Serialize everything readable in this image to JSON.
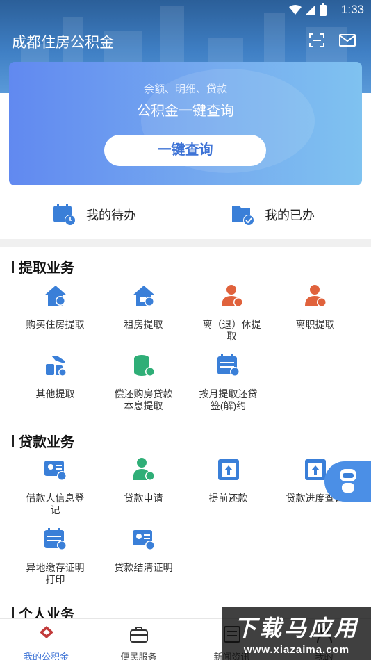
{
  "status_bar": {
    "time": "1:33"
  },
  "header": {
    "title": "成都住房公积金"
  },
  "query_card": {
    "subtitle": "余额、明细、贷款",
    "title": "公积金一键查询",
    "button_label": "一键查询"
  },
  "todo": {
    "pending_label": "我的待办",
    "done_label": "我的已办"
  },
  "sections": {
    "withdraw": {
      "title": "提取业务",
      "items": [
        {
          "label": "购买住房提取"
        },
        {
          "label": "租房提取"
        },
        {
          "label": "离（退）休提取"
        },
        {
          "label": "离职提取"
        },
        {
          "label": "其他提取"
        },
        {
          "label": "偿还购房贷款本息提取"
        },
        {
          "label": "按月提取还贷签(解)约"
        }
      ]
    },
    "loan": {
      "title": "贷款业务",
      "items": [
        {
          "label": "借款人信息登记"
        },
        {
          "label": "贷款申请"
        },
        {
          "label": "提前还款"
        },
        {
          "label": "贷款进度查询"
        },
        {
          "label": "异地缴存证明打印"
        },
        {
          "label": "贷款结清证明"
        }
      ]
    },
    "personal": {
      "title": "个人业务"
    }
  },
  "tabbar": {
    "items": [
      {
        "label": "我的公积金"
      },
      {
        "label": "便民服务"
      },
      {
        "label": "新闻资讯"
      },
      {
        "label": "我的"
      }
    ]
  },
  "watermark": {
    "text": "下载马应用",
    "url": "www.xiazaima.com"
  },
  "colors": {
    "accent": "#3f74d6",
    "icon_blue": "#3a7fd8",
    "icon_orange": "#e0623c",
    "icon_green": "#2fae77"
  }
}
